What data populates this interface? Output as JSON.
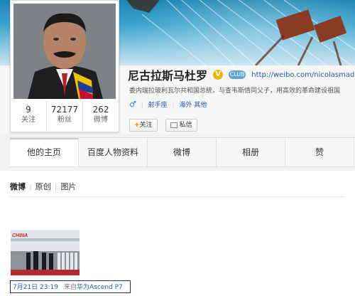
{
  "profile": {
    "name": "尼古拉斯马杜罗",
    "verified_badge": "V",
    "club_badge": "CLUB",
    "url": "http://weibo.com/nicolasmaduro",
    "bio": "委内瑞拉玻利瓦尔共和国总统，与查韦斯情同父子，用高效的革命建设祖国",
    "gender_icon": "♂",
    "zodiac": "射手座",
    "location": "海外 其他",
    "follow_label": "关注",
    "message_label": "私信",
    "stats": [
      {
        "value": "9",
        "label": "关注"
      },
      {
        "value": "72177",
        "label": "粉丝"
      },
      {
        "value": "262",
        "label": "微博"
      }
    ]
  },
  "tabs": [
    {
      "label": "他的主页"
    },
    {
      "label": "百度人物资料"
    },
    {
      "label": "微博"
    },
    {
      "label": "相册"
    },
    {
      "label": "赞"
    }
  ],
  "feed": {
    "filters": [
      "微博",
      "原创",
      "图片"
    ],
    "photo_caption": "CHINA",
    "post": {
      "time": "7月21日 23:19",
      "source_prefix": "来自",
      "source": "华为Ascend P7"
    }
  },
  "colors": {
    "link": "#1a5fa8",
    "verified": "#f0b400",
    "highlight_border": "#1d2a7a"
  }
}
